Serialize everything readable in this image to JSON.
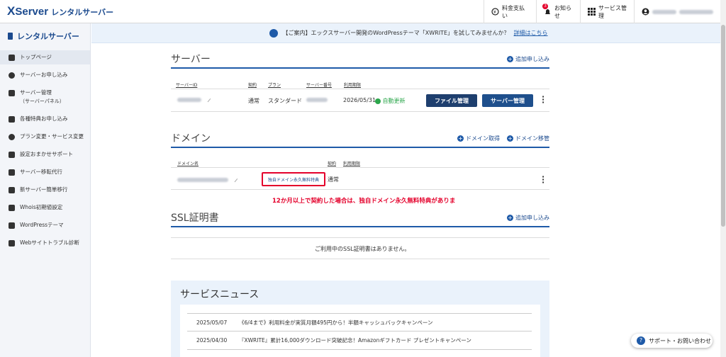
{
  "header": {
    "logo_x": "X",
    "logo_server": "Server",
    "logo_jp": "レンタルサーバー",
    "payment": "料金支払い",
    "notifications": "お知らせ",
    "notification_count": "3",
    "service_mgmt": "サービス管理"
  },
  "notice": {
    "text": "【ご案内】エックスサーバー開発のWordPressテーマ「XWRITE」を試してみませんか？",
    "link": "詳細はこちら"
  },
  "sidebar": {
    "title": "レンタルサーバー",
    "items": [
      {
        "label": "トップページ",
        "icon": "home-icon"
      },
      {
        "label": "サーバーお申し込み",
        "icon": "plus-circle-icon"
      },
      {
        "label": "サーバー管理",
        "sub": "（サーバーパネル）",
        "icon": "server-icon"
      },
      {
        "label": "各種特典お申し込み",
        "icon": "gift-icon"
      },
      {
        "label": "プラン変更・サービス変更",
        "icon": "change-icon"
      },
      {
        "label": "設定おまかせサポート",
        "icon": "wrench-icon"
      },
      {
        "label": "サーバー移転代行",
        "icon": "transfer-icon"
      },
      {
        "label": "新サーバー簡単移行",
        "icon": "migrate-icon"
      },
      {
        "label": "Whois初期値設定",
        "icon": "whois-icon"
      },
      {
        "label": "WordPressテーマ",
        "icon": "theme-icon"
      },
      {
        "label": "Webサイトトラブル診断",
        "icon": "diagnosis-icon"
      }
    ]
  },
  "server": {
    "title": "サーバー",
    "add": "追加申し込み",
    "headers": {
      "id": "サーバーID",
      "contract": "契約",
      "plan": "プラン",
      "number": "サーバー番号",
      "period": "利用期限"
    },
    "row": {
      "contract": "通常",
      "plan": "スタンダード",
      "period": "2026/05/31",
      "renew": "自動更新",
      "file_btn": "ファイル管理",
      "server_btn": "サーバー管理"
    }
  },
  "domain": {
    "title": "ドメイン",
    "acquire": "ドメイン取得",
    "transfer": "ドメイン移管",
    "headers": {
      "name": "ドメイン名",
      "contract": "契約",
      "period": "利用期限"
    },
    "row": {
      "badge": "独自ドメイン永久無料特典",
      "contract": "通常"
    },
    "annotation": "12か月以上で契約した場合は、独自ドメイン永久無料特典がありま"
  },
  "ssl": {
    "title": "SSL証明書",
    "add": "追加申し込み",
    "empty": "ご利用中のSSL証明書はありません。"
  },
  "news": {
    "title": "サービスニュース",
    "items": [
      {
        "date": "2025/05/07",
        "text": "《6/4まで》利用料金が実質月額495円から！半額キャッシュバックキャンペーン"
      },
      {
        "date": "2025/04/30",
        "text": "『XWRITE』累計16,000ダウンロード突破記念！Amazonギフトカード プレゼントキャンペーン"
      }
    ]
  },
  "support": {
    "label": "サポート・お問い合わせ"
  },
  "colors": {
    "brand": "#1b4a8e",
    "button": "#1e4f8c",
    "green": "#2ba64b",
    "red": "#e4002b"
  }
}
